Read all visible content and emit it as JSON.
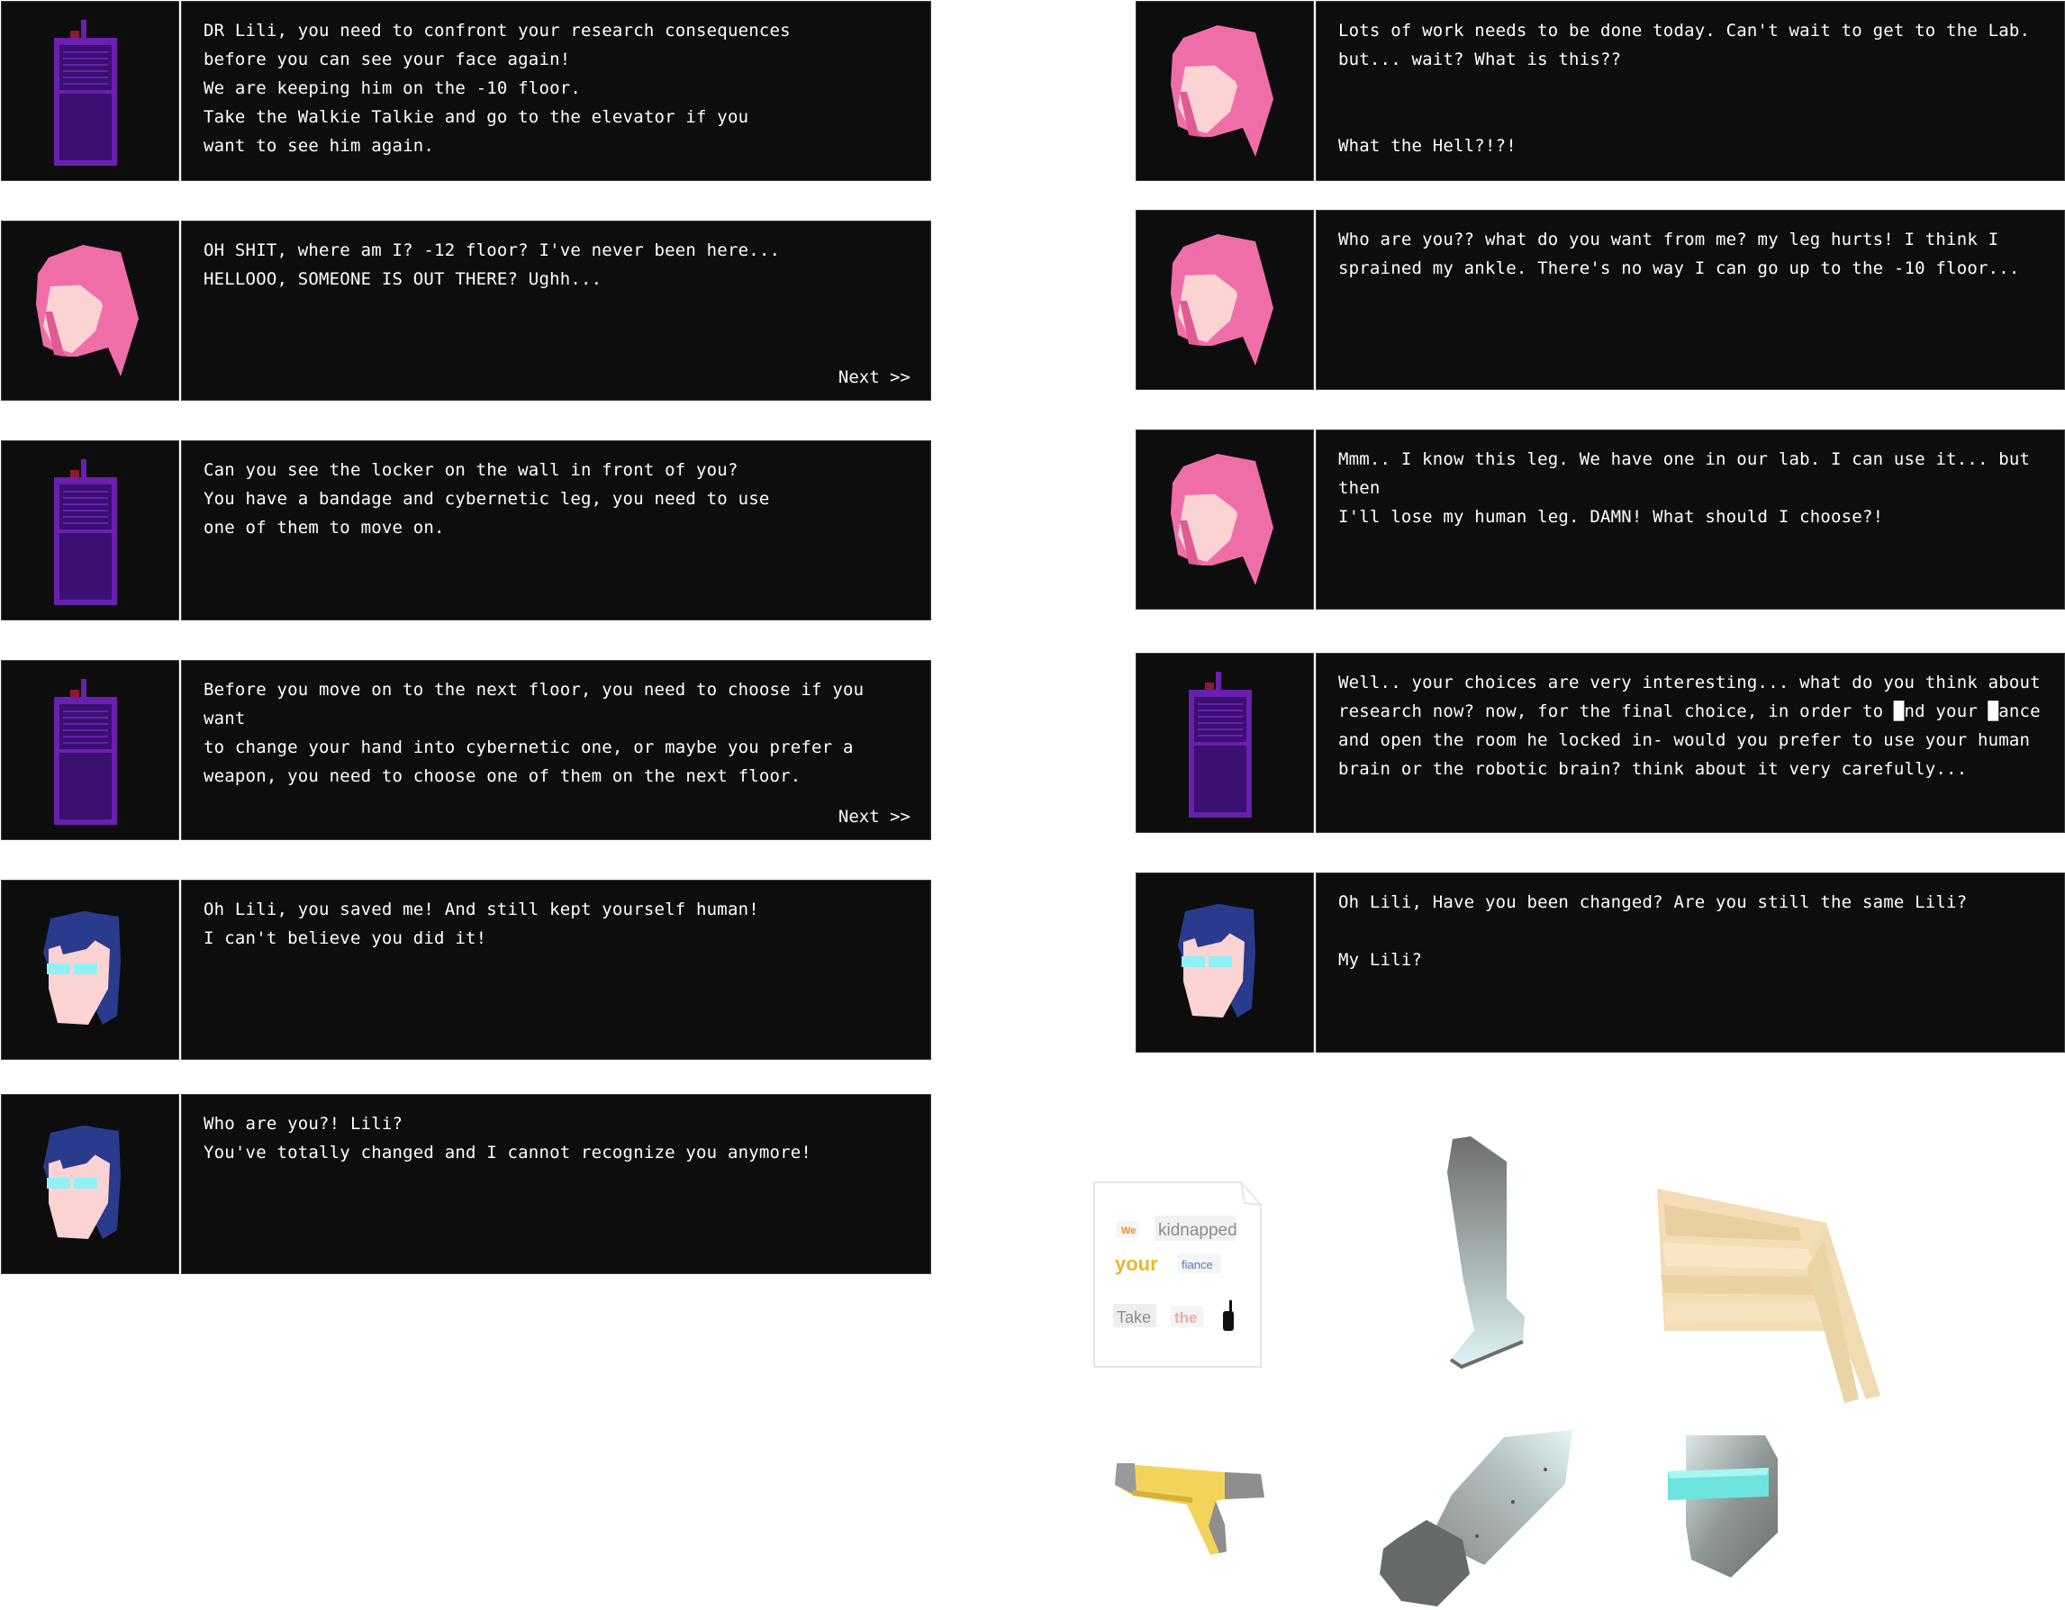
{
  "left_dialogs": [
    {
      "speaker": "walkie-talkie",
      "lines": [
        "DR Lili, you need to confront your research consequences",
        "before you can see your face again!",
        "We are keeping him on the -10 floor.",
        "Take the Walkie Talkie and go to the elevator if you",
        "want to see him again."
      ],
      "next": ""
    },
    {
      "speaker": "lili",
      "lines": [
        "OH SHIT, where am I? -12 floor? I've never been here...",
        "HELLOOO, SOMEONE IS OUT THERE? Ughh..."
      ],
      "next": "Next >>"
    },
    {
      "speaker": "walkie-talkie",
      "lines": [
        "Can you see the locker on the wall in front of you?",
        "You have a bandage and cybernetic leg, you need to use",
        "one of them to move on."
      ],
      "next": ""
    },
    {
      "speaker": "walkie-talkie",
      "lines": [
        "Before you move on to the next floor, you need to choose if you want",
        "to change your hand into cybernetic one, or maybe you prefer a",
        "weapon, you need to choose one of them on the next floor."
      ],
      "next": "Next >>"
    },
    {
      "speaker": "fiance",
      "lines": [
        "Oh Lili, you saved me! And still kept yourself human!",
        "I can't believe you did it!"
      ],
      "next": ""
    },
    {
      "speaker": "fiance",
      "lines": [
        "Who are you?! Lili?",
        "You've totally changed and I cannot recognize you anymore!"
      ],
      "next": ""
    }
  ],
  "right_dialogs": [
    {
      "speaker": "lili",
      "lines": [
        "Lots of work needs to be done today. Can't wait to get to the Lab.",
        "but... wait? What is this??",
        "",
        "",
        "What the Hell?!?!"
      ],
      "next": ""
    },
    {
      "speaker": "lili",
      "lines": [
        "Who are you?? what do you want from me? my leg hurts! I think I",
        "sprained my ankle. There's no way I can go up to the -10 floor..."
      ],
      "next": ""
    },
    {
      "speaker": "lili",
      "lines": [
        "Mmm.. I know this leg. We have one in our lab. I can use it... but then",
        "I'll lose my human leg. DAMN! What should I choose?!"
      ],
      "next": ""
    },
    {
      "speaker": "walkie-talkie",
      "lines": [
        "Well.. your choices are very interesting... what do you think about",
        "research now? now, for the final choice, in order to █nd your █ance",
        "and open the room he locked in- would you prefer to use your human",
        "brain or the robotic brain? think about it very carefully..."
      ],
      "next": ""
    },
    {
      "speaker": "fiance",
      "lines": [
        "Oh Lili, Have you been changed? Are you still the same Lili?",
        "",
        "My Lili?"
      ],
      "next": ""
    }
  ],
  "ransom_note": {
    "words": [
      "We",
      "kidnapped",
      "your",
      "fiance",
      "Take",
      "the"
    ]
  },
  "items": [
    "ransom-note",
    "cybernetic-leg",
    "bandage",
    "gun",
    "cybernetic-arm",
    "robotic-head"
  ],
  "colors": {
    "panel": "#0d0d0d",
    "text": "#ffffff",
    "lili_hair": "#f06ea8",
    "skin": "#fcd3d3",
    "fiance_hair": "#2a3a8c",
    "visor": "#8ff0f5",
    "walkie": "#6a1fb0"
  }
}
